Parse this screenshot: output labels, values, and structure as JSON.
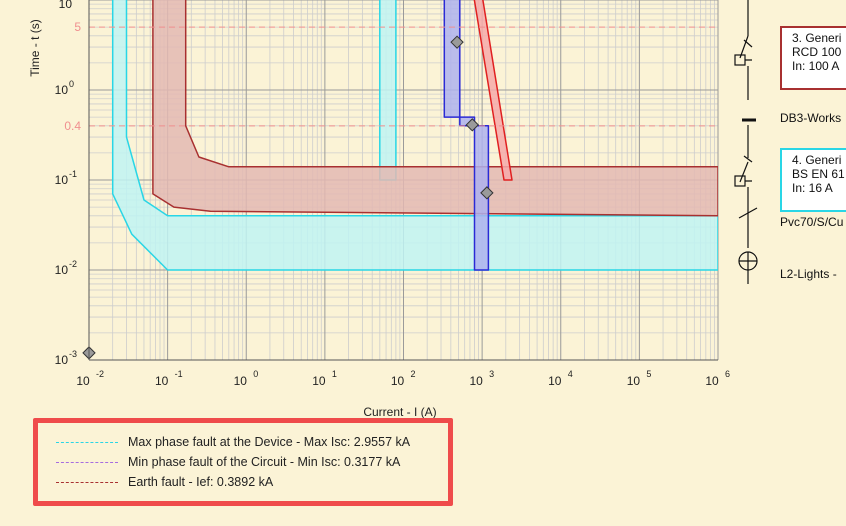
{
  "chart_data": {
    "type": "line",
    "title": "",
    "xlabel": "Current - I (A)",
    "ylabel": "Time - t (s)",
    "xscale": "log",
    "yscale": "log",
    "xlim": [
      0.01,
      1000000
    ],
    "ylim": [
      0.001,
      10
    ],
    "x_ticks": [
      {
        "value": 0.01,
        "base": "10",
        "exp": "-2"
      },
      {
        "value": 0.1,
        "base": "10",
        "exp": "-1"
      },
      {
        "value": 1,
        "base": "10",
        "exp": "0"
      },
      {
        "value": 10,
        "base": "10",
        "exp": "1"
      },
      {
        "value": 100,
        "base": "10",
        "exp": "2"
      },
      {
        "value": 1000,
        "base": "10",
        "exp": "3"
      },
      {
        "value": 10000,
        "base": "10",
        "exp": "4"
      },
      {
        "value": 100000,
        "base": "10",
        "exp": "5"
      },
      {
        "value": 1000000,
        "base": "10",
        "exp": "6"
      }
    ],
    "y_ticks": [
      {
        "value": 0.001,
        "base": "10",
        "exp": "-3"
      },
      {
        "value": 0.01,
        "base": "10",
        "exp": "-2"
      },
      {
        "value": 0.1,
        "base": "10",
        "exp": "-1"
      },
      {
        "value": 1,
        "base": "10",
        "exp": "0"
      },
      {
        "value": 10,
        "base": "10",
        "exp": ""
      }
    ],
    "grid": true,
    "reference_lines": [
      {
        "axis": "y",
        "value": 5,
        "label": "5",
        "color": "#f08f8f"
      },
      {
        "axis": "y",
        "value": 0.4,
        "label": "0.4",
        "color": "#f08f8f"
      }
    ],
    "bands": [
      {
        "name": "cyan-curve",
        "fill": "#bff3f3",
        "stroke": "#29d6e6",
        "polygon": [
          [
            0.02,
            20
          ],
          [
            0.02,
            0.07
          ],
          [
            0.035,
            0.025
          ],
          [
            0.1,
            0.01
          ],
          [
            1000000,
            0.01
          ],
          [
            1000000,
            0.04
          ],
          [
            0.1,
            0.04
          ],
          [
            0.05,
            0.06
          ],
          [
            0.03,
            0.3
          ],
          [
            0.03,
            20
          ]
        ]
      },
      {
        "name": "cyan-rcd",
        "fill": "#bff3f3",
        "stroke": "#29d6e6",
        "polygon": [
          [
            50,
            20
          ],
          [
            50,
            0.1
          ],
          [
            80,
            0.1
          ],
          [
            80,
            20
          ]
        ]
      },
      {
        "name": "earth-band",
        "fill": "#e3b9b3",
        "stroke": "#a83030",
        "polygon": [
          [
            0.065,
            20
          ],
          [
            0.065,
            0.07
          ],
          [
            0.12,
            0.05
          ],
          [
            0.35,
            0.045
          ],
          [
            1000000,
            0.04
          ],
          [
            1000000,
            0.14
          ],
          [
            0.6,
            0.14
          ],
          [
            0.25,
            0.18
          ],
          [
            0.17,
            0.4
          ],
          [
            0.17,
            20
          ]
        ]
      },
      {
        "name": "blue-mcb",
        "fill": "#aeb2ef",
        "stroke": "#2a2ad6",
        "polygon": [
          [
            330,
            20
          ],
          [
            330,
            0.5
          ],
          [
            800,
            0.5
          ],
          [
            800,
            0.01
          ],
          [
            1200,
            0.01
          ],
          [
            1200,
            0.4
          ],
          [
            520,
            0.4
          ],
          [
            520,
            20
          ]
        ]
      },
      {
        "name": "red-fuse",
        "fill": "#f6a9a9",
        "stroke": "#e02020",
        "polygon": [
          [
            700,
            20
          ],
          [
            1900,
            0.1
          ],
          [
            2400,
            0.1
          ],
          [
            900,
            20
          ]
        ]
      }
    ],
    "markers": [
      {
        "x": 0.01,
        "y": 0.0012
      },
      {
        "x": 480,
        "y": 3.4
      },
      {
        "x": 750,
        "y": 0.41
      },
      {
        "x": 1150,
        "y": 0.072
      }
    ]
  },
  "legend": {
    "items": [
      {
        "label": "Max phase fault at the Device - Max Isc: 2.9557 kA",
        "color": "#29d6e6"
      },
      {
        "label": "Min phase fault of the Circuit - Min Isc: 0.3177 kA",
        "color": "#a66be0"
      },
      {
        "label": "Earth fault - Ief: 0.3892 kA",
        "color": "#a83030"
      }
    ]
  },
  "schematic": {
    "device3": {
      "line1": "3. Generi",
      "line2": "RCD 100",
      "line3": "In: 100 A",
      "border": "#a83030"
    },
    "db_label": "DB3-Works",
    "device4": {
      "line1": "4. Generi",
      "line2": "BS EN 61",
      "line3": "In: 16 A",
      "border": "#29d6e6"
    },
    "cable_label": "Pvc70/S/Cu",
    "circuit_label": "L2-Lights -"
  }
}
